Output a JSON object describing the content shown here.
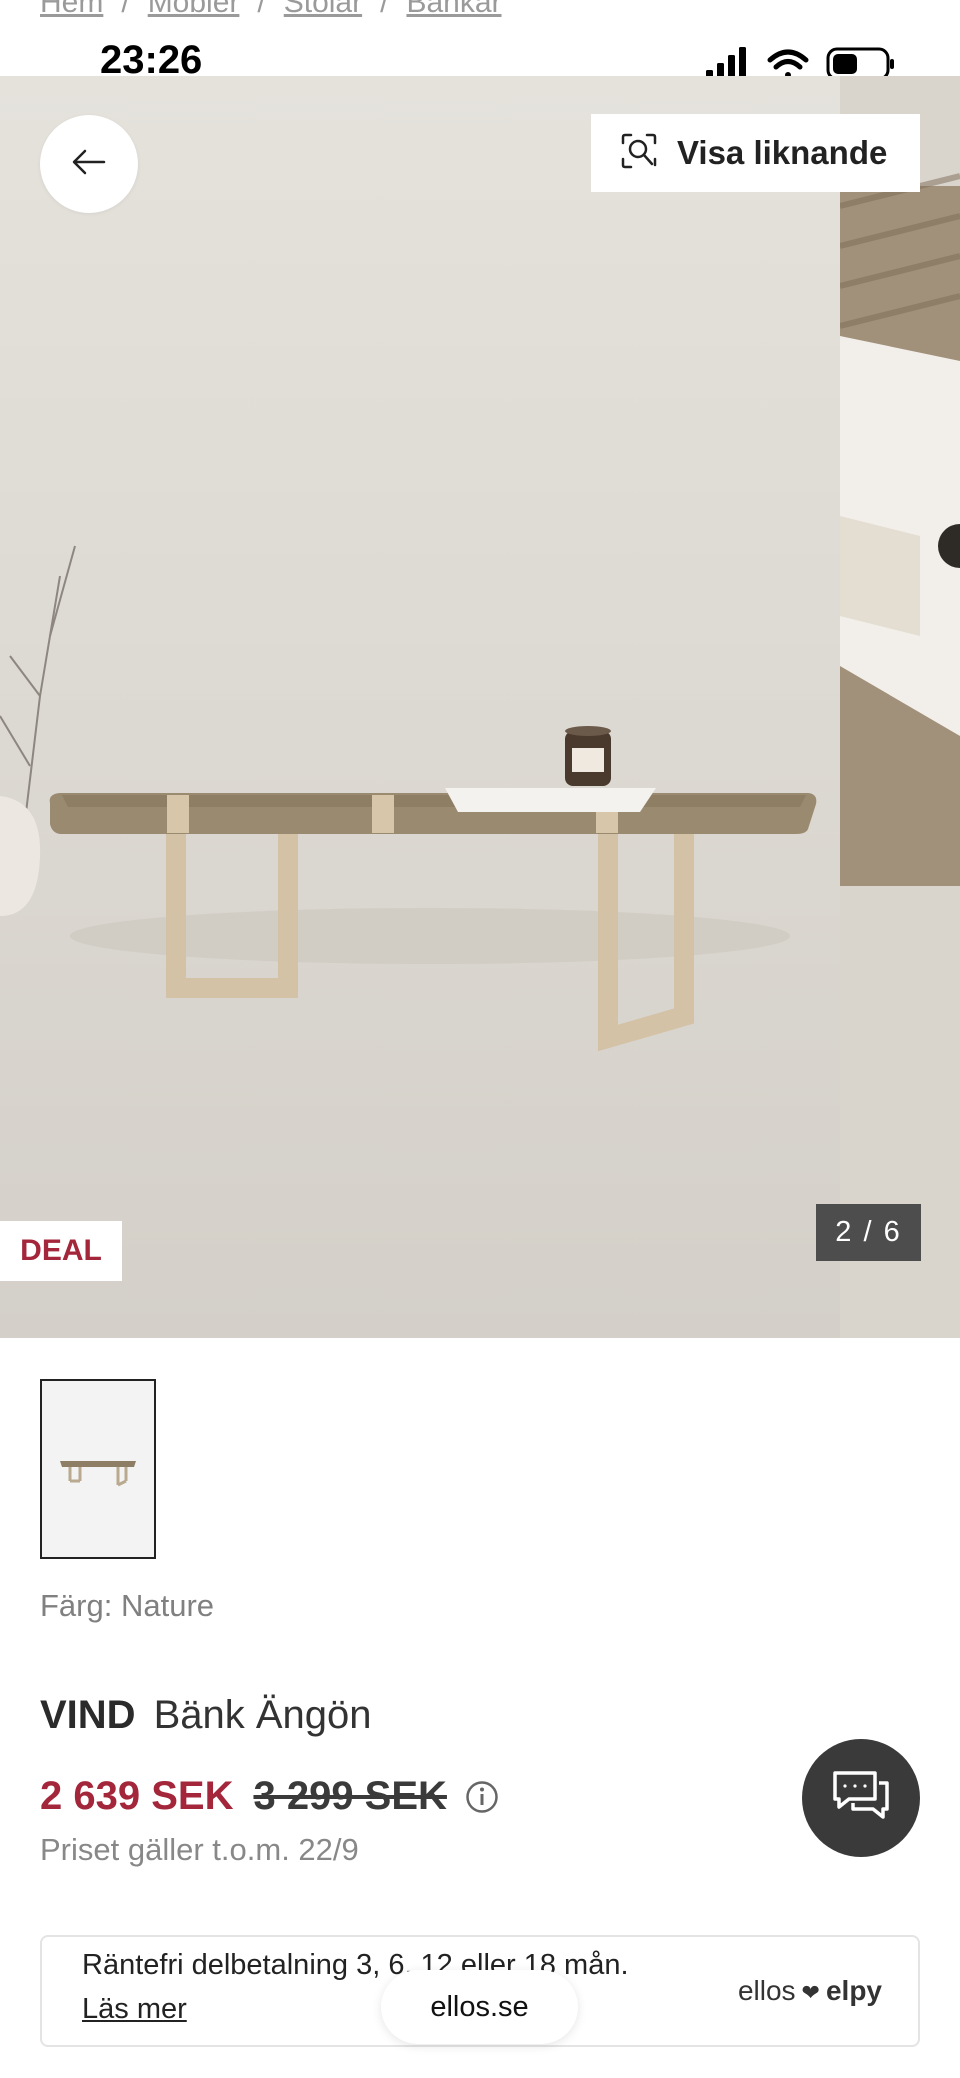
{
  "breadcrumb": {
    "items": [
      "Hem",
      "Möbler",
      "Stolar",
      "Bänkar"
    ],
    "separator": "/"
  },
  "status_bar": {
    "time": "23:26"
  },
  "gallery": {
    "similar_button_label": "Visa liknande",
    "badge": "DEAL",
    "counter": "2 / 6"
  },
  "product": {
    "color_label": "Färg: Nature",
    "brand": "VIND",
    "name": "Bänk Ängön",
    "price_now": "2 639 SEK",
    "price_old": "3 299 SEK",
    "price_note": "Priset gäller t.o.m. 22/9"
  },
  "financing": {
    "text": "Räntefri delbetalning 3, 6, 12 eller 18 mån.",
    "link": "Läs mer",
    "logo_left": "ellos",
    "logo_right": "elpy"
  },
  "browser": {
    "url": "ellos.se"
  },
  "icons": {
    "back": "arrow-left-icon",
    "similar": "visual-search-icon",
    "info": "info-icon",
    "chat": "chat-icon",
    "heart": "heart-icon"
  },
  "colors": {
    "deal_red": "#a3263a",
    "text_dark": "#222222",
    "muted": "#888888",
    "chat_bg": "#3a3a3a"
  }
}
